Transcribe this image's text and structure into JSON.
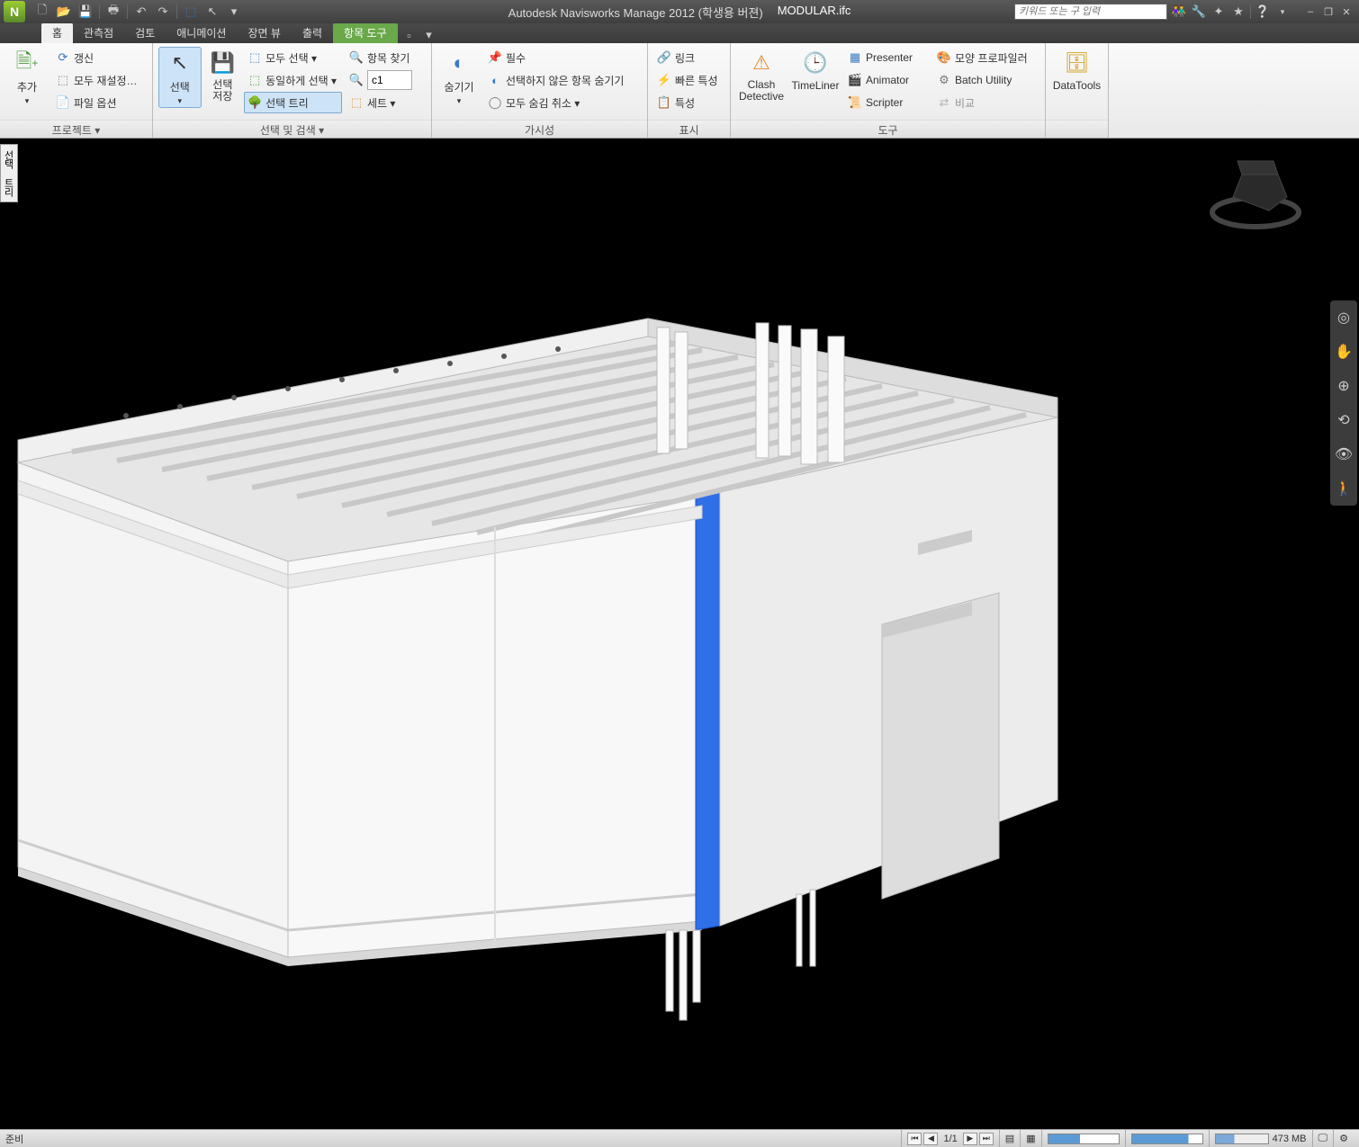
{
  "title": {
    "app": "Autodesk Navisworks Manage 2012 (학생용 버젼)",
    "document": "MODULAR.ifc",
    "search_placeholder": "키워드 또는 구 입력"
  },
  "window_controls": {
    "min": "–",
    "max": "❐",
    "close": "✕"
  },
  "tabs": {
    "home": "홈",
    "viewpoint": "관측점",
    "review": "검토",
    "animation": "애니메이션",
    "scene_view": "장면 뷰",
    "output": "출력",
    "item_tools": "항목 도구"
  },
  "ribbon": {
    "project_group": "프로젝트 ▾",
    "append": {
      "label": "추가",
      "dd": "▾"
    },
    "refresh": "갱신",
    "reset_all": "모두 재설정…",
    "file_options": "파일 옵션",
    "select_search_group": "선택 및 검색 ▾",
    "select": {
      "label": "선택",
      "dd": "▾"
    },
    "save_selection": "선택\n저장",
    "select_all": "모두 선택 ▾",
    "select_same": "동일하게 선택 ▾",
    "selection_tree": "선택 트리",
    "find_items": "항목 찾기",
    "quick_find_value": "c1",
    "sets": "세트 ▾",
    "visibility_group": "가시성",
    "hide": {
      "label": "숨기기",
      "dd": "▾"
    },
    "require": "필수",
    "hide_unselected": "선택하지 않은 항목 숨기기",
    "unhide_all": "모두 숨김 취소 ▾",
    "display_group": "표시",
    "links": "링크",
    "quick_props": "빠른 특성",
    "properties": "특성",
    "tools_group": "도구",
    "clash": "Clash\nDetective",
    "timeliner": "TimeLiner",
    "presenter": "Presenter",
    "animator": "Animator",
    "scripter": "Scripter",
    "profiler": "모양 프로파일러",
    "batch": "Batch Utility",
    "compare": "비교",
    "datatools": "DataTools"
  },
  "panel_tab": "선택 트리",
  "status": {
    "ready": "준비",
    "sheet": "1/1",
    "memory": "473 MB"
  }
}
